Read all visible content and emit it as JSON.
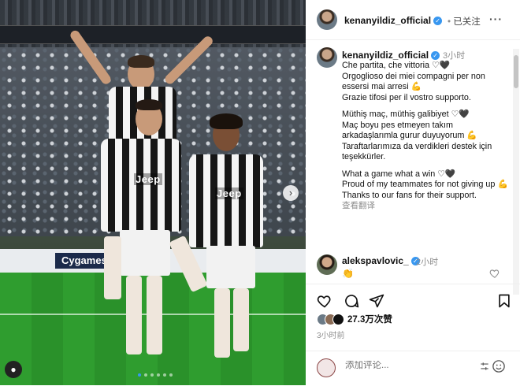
{
  "photo": {
    "ad_text": "Cygames",
    "sponsor": "Jeep",
    "next_icon": "chevron-right-icon",
    "carousel_count": 6,
    "carousel_active": 1
  },
  "post": {
    "username": "kenanyildiz_official",
    "follow_status": "已关注",
    "more_icon": "more-horizontal-icon",
    "time": "3小时",
    "caption_it": "Che partita, che vittoria ♡🖤\nOrgoglioso dei miei compagni per non essersi mai arresi 💪\nGrazie tifosi per il vostro supporto.",
    "caption_tr": "Müthiş maç, müthiş galibiyet ♡🖤\nMaç boyu pes etmeyen takım arkadaşlarımla gurur duyuyorum 💪\nTaraftarlarımıza da verdikleri destek için teşekkürler.",
    "caption_en": "What a game what a win ♡🖤\nProud of my teammates for not giving up 💪 Thanks to our fans for their support.",
    "see_translation": "查看翻译"
  },
  "comment": {
    "username": "aleksp avlovic_",
    "time": "2小时",
    "text": "👏"
  },
  "stats": {
    "likes": "27.3万次赞",
    "posted": "3小时前"
  },
  "composer": {
    "placeholder": "添加评论..."
  },
  "colors": {
    "verified": "#3897f0",
    "muted": "#8e8e8e"
  }
}
